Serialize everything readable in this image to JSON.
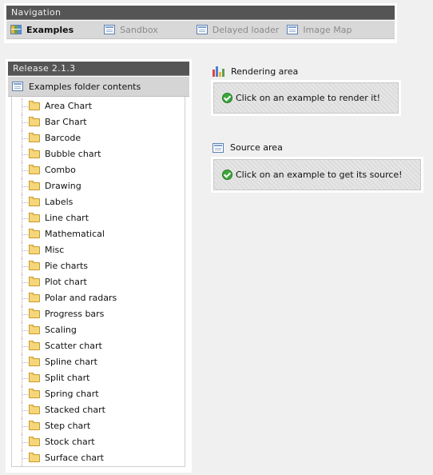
{
  "navigation": {
    "title": "Navigation",
    "tabs": [
      {
        "label": "Examples",
        "icon": "grid-icon",
        "active": true
      },
      {
        "label": "Sandbox",
        "icon": "page-icon",
        "active": false
      },
      {
        "label": "Delayed loader",
        "icon": "page-icon",
        "active": false
      },
      {
        "label": "Image Map",
        "icon": "page-icon",
        "active": false
      }
    ]
  },
  "release": {
    "title": "Release 2.1.3",
    "folder_header": "Examples folder contents",
    "folders": [
      "Area Chart",
      "Bar Chart",
      "Barcode",
      "Bubble chart",
      "Combo",
      "Drawing",
      "Labels",
      "Line chart",
      "Mathematical",
      "Misc",
      "Pie charts",
      "Plot chart",
      "Polar and radars",
      "Progress bars",
      "Scaling",
      "Scatter chart",
      "Spline chart",
      "Split chart",
      "Spring chart",
      "Stacked chart",
      "Step chart",
      "Stock chart",
      "Surface chart"
    ]
  },
  "rendering": {
    "title": "Rendering area",
    "icon": "bar-chart-icon",
    "message": "Click on an example to render it!"
  },
  "source": {
    "title": "Source area",
    "icon": "page-icon",
    "message": "Click on an example to get its source!"
  },
  "colors": {
    "title_bar": "#555555",
    "success_check": "#3da83a",
    "folder": "#f6d67a"
  }
}
